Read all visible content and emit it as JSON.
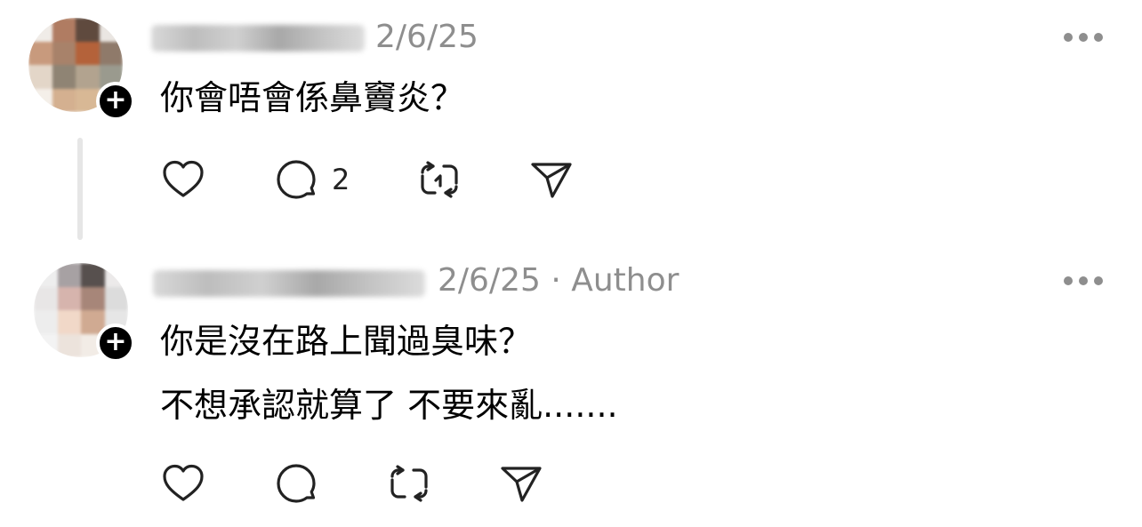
{
  "posts": [
    {
      "date": "2/6/25",
      "meta_suffix": "",
      "lines": [
        "你會唔會係鼻竇炎？"
      ],
      "reply_count": "2"
    },
    {
      "date": "2/6/25",
      "meta_suffix": " · Author",
      "lines": [
        "你是沒在路上聞過臭味？",
        "不想承認就算了 不要來亂......."
      ],
      "reply_count": ""
    }
  ],
  "icons": {
    "like": "heart-icon",
    "reply": "comment-bubble-icon",
    "repost": "repost-icon",
    "share": "paper-plane-icon",
    "more": "more-dots-icon",
    "follow": "plus-icon"
  },
  "colors": {
    "text": "#000000",
    "meta": "#8e8e8e",
    "icon": "#222222",
    "thread_line": "#e6e6e6"
  }
}
